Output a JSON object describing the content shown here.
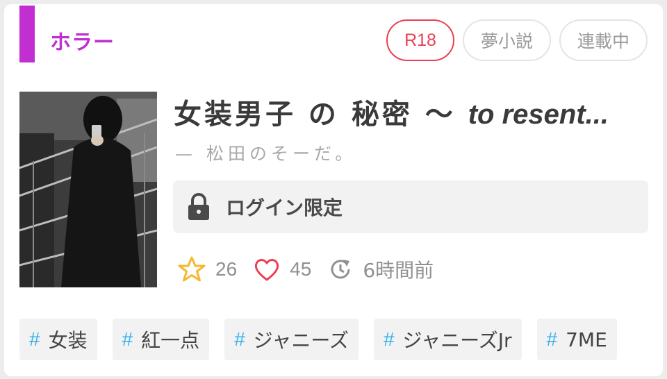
{
  "genre": {
    "label": "ホラー",
    "color": "#c12fd0"
  },
  "badges": [
    {
      "label": "R18"
    },
    {
      "label": "夢小説"
    },
    {
      "label": "連載中"
    }
  ],
  "novel": {
    "title_jp": "女装男子 の 秘密 〜",
    "title_en": "to resent...",
    "author": "— 松田のそーだ。",
    "cover_icon": "cover-photo"
  },
  "login": {
    "label": "ログイン限定",
    "icon": "lock-icon"
  },
  "stats": {
    "stars": "26",
    "hearts": "45",
    "updated": "6時間前"
  },
  "tags": [
    {
      "label": "女装"
    },
    {
      "label": "紅一点"
    },
    {
      "label": "ジャニーズ"
    },
    {
      "label": "ジャニーズJr"
    },
    {
      "label": "7ME"
    }
  ],
  "colors": {
    "accent": "#c12fd0",
    "r18": "#ec3e55",
    "star": "#f5b82e",
    "heart": "#ec3e55",
    "hash": "#3ab0ea"
  }
}
